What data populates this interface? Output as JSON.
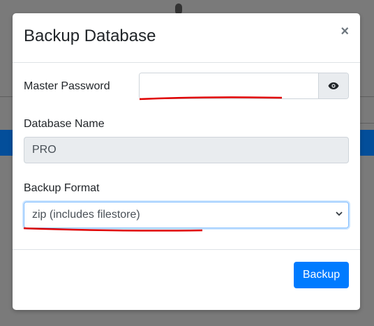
{
  "modal": {
    "title": "Backup Database",
    "close_symbol": "×",
    "master_password": {
      "label": "Master Password",
      "value": "",
      "placeholder": ""
    },
    "database_name": {
      "label": "Database Name",
      "value": "PRO"
    },
    "backup_format": {
      "label": "Backup Format",
      "selected": "zip (includes filestore)"
    },
    "footer": {
      "backup_label": "Backup"
    }
  },
  "icons": {
    "reveal": "eye-icon",
    "dropdown": "chevron-down-icon",
    "close": "close-icon"
  },
  "colors": {
    "primary": "#007bff",
    "annotation": "#e00000"
  }
}
